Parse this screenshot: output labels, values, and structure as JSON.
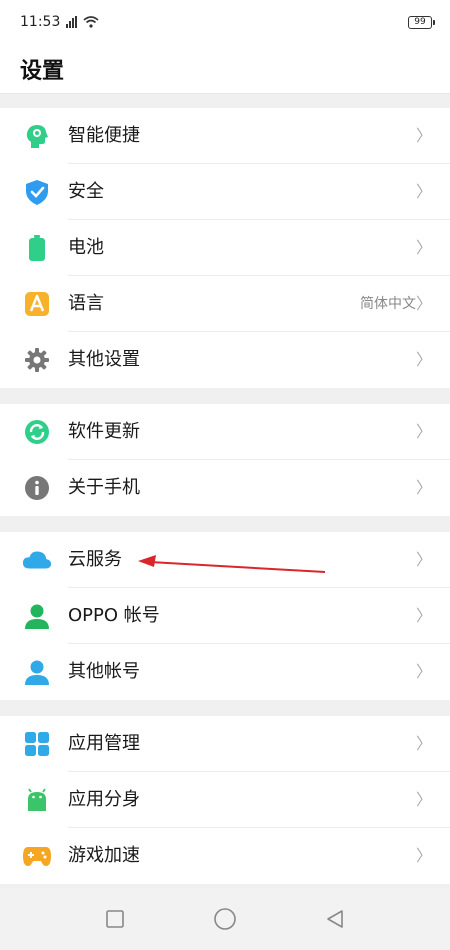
{
  "status": {
    "time": "11:53",
    "battery": "99"
  },
  "header": {
    "title": "设置"
  },
  "groups": [
    {
      "items": [
        {
          "label": "智能便捷"
        },
        {
          "label": "安全"
        },
        {
          "label": "电池"
        },
        {
          "label": "语言",
          "value": "简体中文"
        },
        {
          "label": "其他设置"
        }
      ]
    },
    {
      "items": [
        {
          "label": "软件更新"
        },
        {
          "label": "关于手机"
        }
      ]
    },
    {
      "items": [
        {
          "label": "云服务"
        },
        {
          "label": "OPPO 帐号"
        },
        {
          "label": "其他帐号"
        }
      ]
    },
    {
      "items": [
        {
          "label": "应用管理"
        },
        {
          "label": "应用分身"
        },
        {
          "label": "游戏加速"
        }
      ]
    }
  ],
  "chevron": "〉",
  "colors": {
    "accent_green": "#2fcf8a",
    "shield_blue": "#2f9cf0",
    "annotation_red": "#d9262a"
  }
}
